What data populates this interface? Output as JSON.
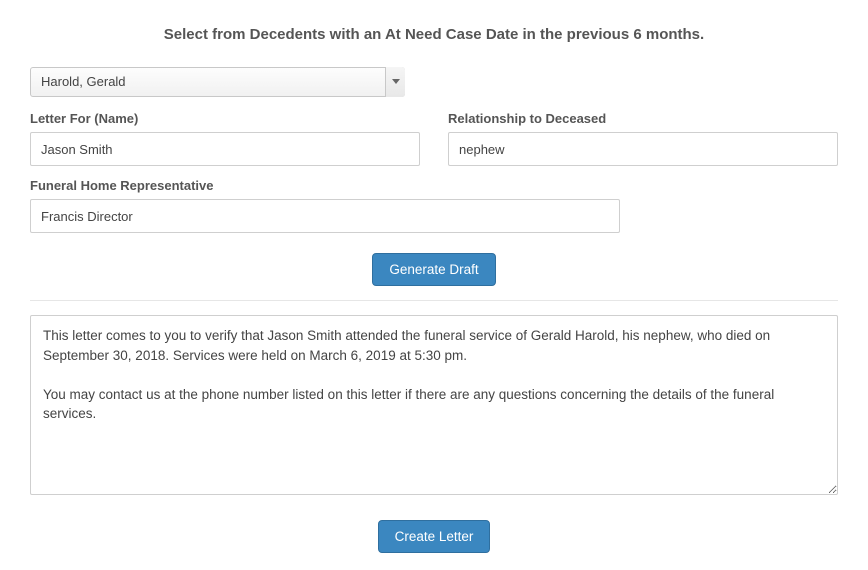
{
  "heading": "Select from Decedents with an At Need Case Date in the previous 6 months.",
  "decedent_select": {
    "selected": "Harold, Gerald"
  },
  "fields": {
    "letter_for": {
      "label": "Letter For (Name)",
      "value": "Jason Smith"
    },
    "relationship": {
      "label": "Relationship to Deceased",
      "value": "nephew"
    },
    "representative": {
      "label": "Funeral Home Representative",
      "value": "Francis Director"
    }
  },
  "buttons": {
    "generate": "Generate Draft",
    "create": "Create Letter"
  },
  "letter_body": "This letter comes to you to verify that Jason Smith attended the funeral service of Gerald Harold, his nephew, who died on September 30, 2018. Services were held on March 6, 2019 at 5:30 pm.\n\nYou may contact us at the phone number listed on this letter if there are any questions concerning the details of the funeral services."
}
